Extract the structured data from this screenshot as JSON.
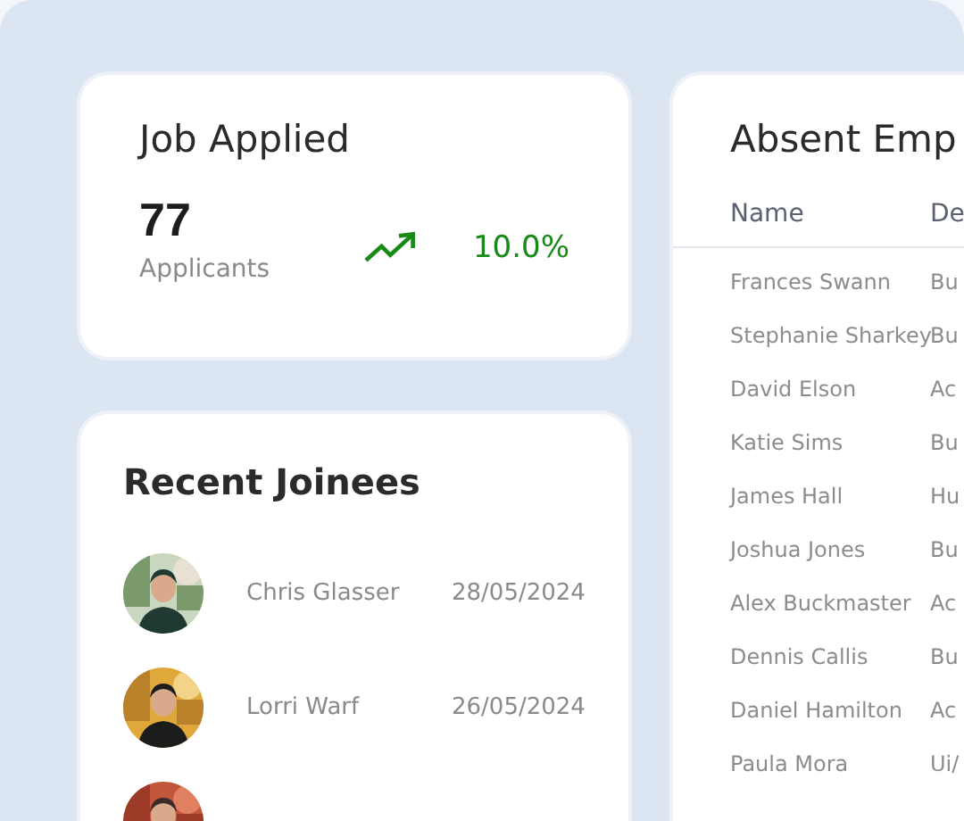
{
  "job_applied": {
    "title": "Job Applied",
    "count": "77",
    "caption": "Applicants",
    "rising": true,
    "change": "10.0%"
  },
  "recent_joinees": {
    "title": "Recent Joinees",
    "items": [
      {
        "name": "Chris Glasser",
        "date": "28/05/2024",
        "kind": "picture"
      },
      {
        "name": "Lorri Warf",
        "date": "26/05/2024",
        "kind": "picture"
      },
      {
        "kind": "picture"
      }
    ]
  },
  "absent_employees": {
    "title": "Absent Emp",
    "columns": [
      "Name",
      "De"
    ],
    "rows": [
      [
        "Frances Swann",
        "Bu"
      ],
      [
        "Stephanie Sharkey",
        "Bu"
      ],
      [
        "David Elson",
        "Ac"
      ],
      [
        "Katie Sims",
        "Bu"
      ],
      [
        "James Hall",
        "Hu"
      ],
      [
        "Joshua Jones",
        "Bu"
      ],
      [
        "Alex Buckmaster",
        "Ac"
      ],
      [
        "Dennis Callis",
        "Bu"
      ],
      [
        "Daniel Hamilton",
        "Ac"
      ],
      [
        "Paula Mora",
        "Ui/"
      ]
    ]
  }
}
